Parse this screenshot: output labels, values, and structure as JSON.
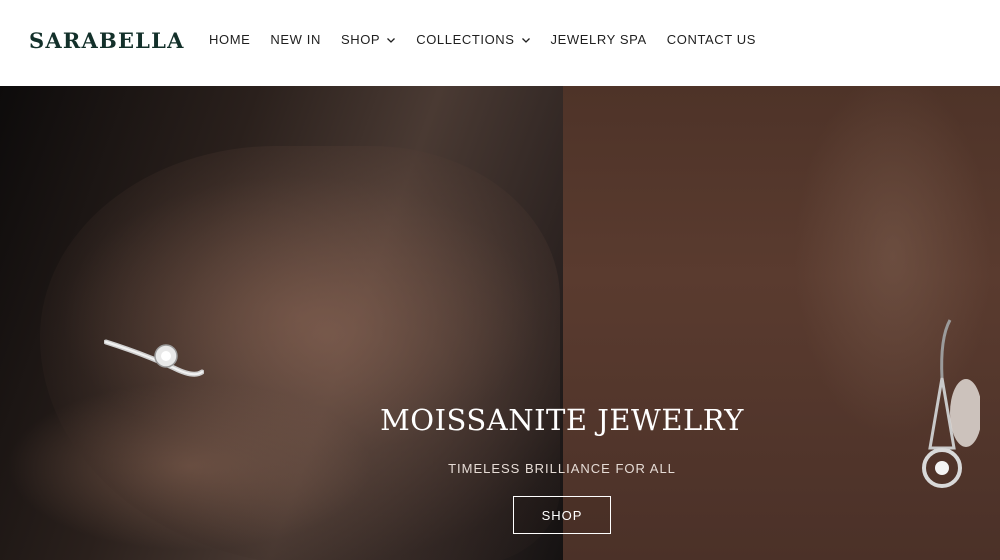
{
  "brand": {
    "name": "SARABELLA"
  },
  "nav": {
    "items": [
      {
        "label": "HOME",
        "has_dropdown": false
      },
      {
        "label": "NEW IN",
        "has_dropdown": false
      },
      {
        "label": "SHOP",
        "has_dropdown": true
      },
      {
        "label": "COLLECTIONS",
        "has_dropdown": true
      },
      {
        "label": "JEWELRY SPA",
        "has_dropdown": false
      },
      {
        "label": "CONTACT US",
        "has_dropdown": false
      }
    ]
  },
  "hero": {
    "title": "MOISSANITE JEWELRY",
    "subtitle": "TIMELESS BRILLIANCE FOR ALL",
    "button_label": "SHOP"
  },
  "colors": {
    "logo": "#13302a",
    "nav_text": "#1f1f1f",
    "hero_text": "#ffffff"
  }
}
